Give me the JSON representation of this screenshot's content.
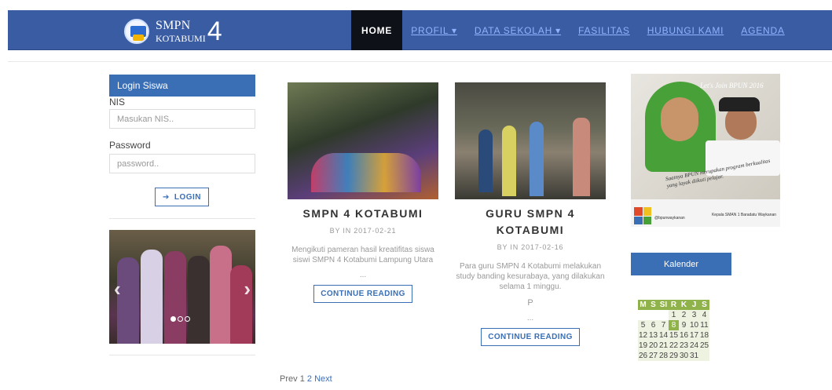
{
  "header": {
    "logo": {
      "line1": "SMPN",
      "line2": "KOTABUMI",
      "number": "4"
    },
    "nav": [
      {
        "label": "HOME",
        "active": true
      },
      {
        "label": "PROFIL ▾",
        "active": false
      },
      {
        "label": "DATA SEKOLAH ▾",
        "active": false
      },
      {
        "label": "FASILITAS",
        "active": false
      },
      {
        "label": "HUBUNGI KAMI",
        "active": false
      },
      {
        "label": "AGENDA",
        "active": false
      }
    ]
  },
  "login": {
    "title": "Login Siswa",
    "nis_label": "NIS",
    "nis_placeholder": "Masukan NIS..",
    "password_label": "Password",
    "password_placeholder": "password..",
    "button": "LOGIN"
  },
  "posts": [
    {
      "title": "SMPN 4 KOTABUMI",
      "meta": "BY IN 2017-02-21",
      "excerpt": "Mengikuti pameran hasil kreatifitas siswa siswi SMPN 4 Kotabumi Lampung Utara",
      "ellipsis": "...",
      "button": "CONTINUE READING"
    },
    {
      "title": "GURU SMPN 4 KOTABUMI",
      "meta": "BY IN 2017-02-16",
      "excerpt": "Para guru SMPN 4 Kotabumi melakukan study banding kesurabaya, yang dilakukan selama 1 minggu.",
      "extra": "P",
      "ellipsis": "...",
      "button": "CONTINUE READING"
    }
  ],
  "pagination": {
    "prev": "Prev",
    "p1": "1",
    "p2": "2",
    "next": "Next"
  },
  "banner": {
    "tagline": "Let's Join BPUN 2016",
    "quote": "Saatnya BPUN merupakan program berkualitas yang layak diikuti pelajar.",
    "logo": "BPUN",
    "handle": "@bpunwaykanan",
    "sign": "Kepala SMAN 1 Baradatu Waykanan"
  },
  "kalender": {
    "title": "Kalender",
    "days": [
      "M",
      "S",
      "SI",
      "R",
      "K",
      "J",
      "S"
    ],
    "weeks": [
      [
        "",
        "",
        "",
        "",
        "1",
        "2",
        "3",
        "4"
      ],
      [
        "",
        "5",
        "6",
        "7",
        "8",
        "9",
        "10",
        "11"
      ],
      [
        "",
        "12",
        "13",
        "14",
        "15",
        "16",
        "17",
        "18"
      ],
      [
        "",
        "19",
        "20",
        "21",
        "22",
        "23",
        "24",
        "25"
      ],
      [
        "",
        "26",
        "27",
        "28",
        "29",
        "30",
        "31",
        ""
      ]
    ],
    "today": "8"
  }
}
